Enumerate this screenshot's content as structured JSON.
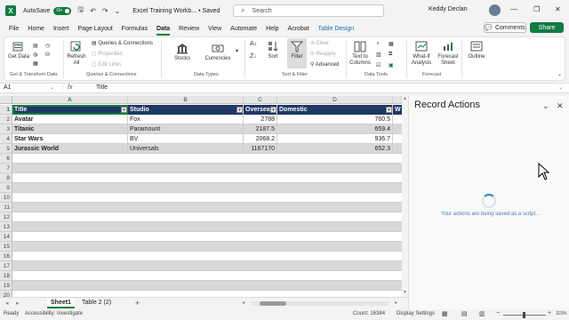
{
  "titlebar": {
    "app_icon": "X",
    "autosave_label": "AutoSave",
    "autosave_state": "On",
    "doc_title": "Excel Training Workb... • Saved",
    "search_placeholder": "Search",
    "user_name": "Keddy Declan"
  },
  "menu": {
    "items": [
      "File",
      "Home",
      "Insert",
      "Page Layout",
      "Formulas",
      "Data",
      "Review",
      "View",
      "Automate",
      "Help",
      "Acrobat",
      "Table Design"
    ],
    "active": "Data",
    "comments_label": "Comments",
    "share_label": "Share"
  },
  "ribbon": {
    "get_data": "Get Data",
    "refresh_all": "Refresh All",
    "queries_connections": "Queries & Connections",
    "properties": "Properties",
    "edit_links": "Edit Links",
    "stocks": "Stocks",
    "currencies": "Currencies",
    "sort": "Sort",
    "filter": "Filter",
    "clear": "Clear",
    "reapply": "Reapply",
    "advanced": "Advanced",
    "text_to_columns": "Text to Columns",
    "what_if": "What-If Analysis",
    "forecast_sheet": "Forecast Sheet",
    "outline": "Outline",
    "groups": {
      "get_transform": "Get & Transform Data",
      "queries": "Queries & Connections",
      "data_types": "Data Types",
      "sort_filter": "Sort & Filter",
      "data_tools": "Data Tools",
      "forecast": "Forecast"
    }
  },
  "formula_bar": {
    "name_box": "A1",
    "fx": "fx",
    "value": "Title"
  },
  "sheet": {
    "columns": [
      "A",
      "B",
      "C",
      "D"
    ],
    "rows": [
      "1",
      "2",
      "3",
      "4",
      "5",
      "6",
      "7",
      "8",
      "9",
      "10",
      "11",
      "12",
      "13",
      "14",
      "15",
      "16",
      "17",
      "18",
      "19",
      "20"
    ],
    "header": [
      "Title",
      "Studio",
      "Oversea",
      "Domestic"
    ],
    "data": [
      [
        "Avatar",
        "Fox",
        "2788",
        "760.5"
      ],
      [
        "Titanic",
        "Paramount",
        "2187.5",
        "659.4"
      ],
      [
        "Star Wars",
        "BV",
        "2068.2",
        "936.7"
      ],
      [
        "Jurassic World",
        "Universals",
        "1167170",
        "652.3"
      ]
    ],
    "next_col_peek": "W"
  },
  "sheet_tabs": {
    "tabs": [
      "Sheet1",
      "Table 2 (2)"
    ],
    "active": "Sheet1",
    "add": "+"
  },
  "status": {
    "ready": "Ready",
    "accessibility": "Accessibility: Investigate",
    "count": "Count: 16384",
    "display_settings": "Display Settings",
    "zoom": "115%"
  },
  "panel": {
    "title": "Record Actions",
    "message": "Your actions are being saved as a script..."
  },
  "colors": {
    "excel_green": "#107c41",
    "table_header": "#1f3864",
    "band": "#d9d9d9"
  }
}
